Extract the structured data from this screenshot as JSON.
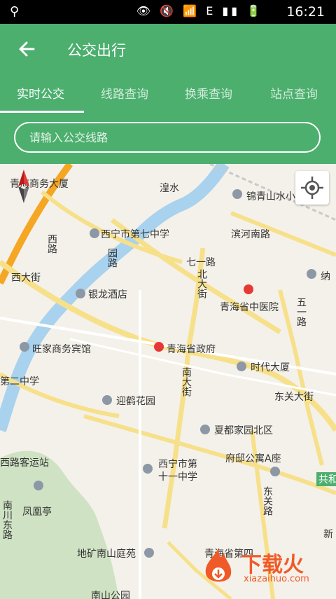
{
  "status_bar": {
    "time": "16:21",
    "usb_icon": "usb-icon",
    "network_label": "E"
  },
  "header": {
    "back_icon": "back-arrow-icon",
    "title": "公交出行"
  },
  "tabs": [
    {
      "label": "实时公交",
      "active": true
    },
    {
      "label": "线路查询",
      "active": false
    },
    {
      "label": "换乘查询",
      "active": false
    },
    {
      "label": "站点查询",
      "active": false
    }
  ],
  "search": {
    "placeholder": "请输入公交线路"
  },
  "map": {
    "labels": [
      {
        "text": "青海商务大厦"
      },
      {
        "text": "湟水"
      },
      {
        "text": "锦青山水小区"
      },
      {
        "text": "西宁市第七中学"
      },
      {
        "text": "滨河南路"
      },
      {
        "text": "西大街"
      },
      {
        "text": "银龙酒店"
      },
      {
        "text": "七一路"
      },
      {
        "text": "纳"
      },
      {
        "text": "北大街"
      },
      {
        "text": "青海省中医院"
      },
      {
        "text": "五一路"
      },
      {
        "text": "旺家商务宾馆"
      },
      {
        "text": "青海省政府"
      },
      {
        "text": "时代大厦"
      },
      {
        "text": "第二中学"
      },
      {
        "text": "南大街"
      },
      {
        "text": "迎鹤花园"
      },
      {
        "text": "东关大街"
      },
      {
        "text": "夏都家园北区"
      },
      {
        "text": "西路客运站"
      },
      {
        "text": "府邸公寓A座"
      },
      {
        "text": "西宁市第"
      },
      {
        "text": "十一中学"
      },
      {
        "text": "共和"
      },
      {
        "text": "凤凰亭"
      },
      {
        "text": "南川东路"
      },
      {
        "text": "东关路"
      },
      {
        "text": "新"
      },
      {
        "text": "地矿南山庭苑"
      },
      {
        "text": "青海省第四"
      },
      {
        "text": "南山公园"
      },
      {
        "text": "西路"
      },
      {
        "text": "园路"
      }
    ],
    "locate_icon": "locate-icon",
    "compass_icon": "compass-icon"
  },
  "watermark": {
    "text": "下载火",
    "sub": "xiazaihuo.com"
  }
}
